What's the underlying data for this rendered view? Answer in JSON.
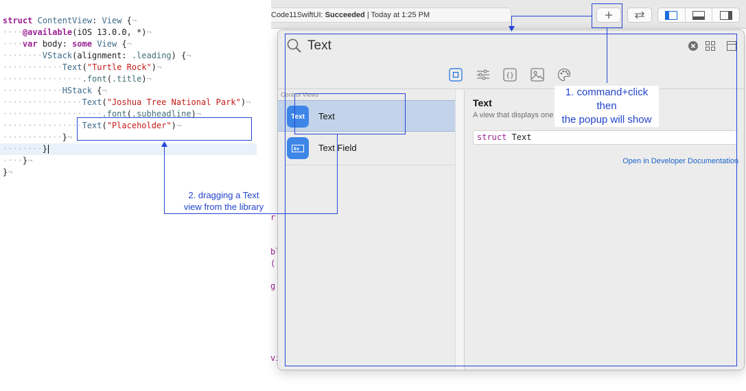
{
  "editor": {
    "lines": [
      {
        "tokens": [
          {
            "t": "struct",
            "c": "kw"
          },
          {
            "t": " "
          },
          {
            "t": "ContentView",
            "c": "ty"
          },
          {
            "t": ": "
          },
          {
            "t": "View",
            "c": "ty"
          },
          {
            "t": " {"
          }
        ],
        "pilcrow": true
      },
      {
        "tokens": [
          {
            "t": "····",
            "c": "dots"
          },
          {
            "t": "@available",
            "c": "kw"
          },
          {
            "t": "(iOS 13.0.0, *)"
          }
        ],
        "pilcrow": true
      },
      {
        "tokens": [
          {
            "t": "····",
            "c": "dots"
          },
          {
            "t": "var",
            "c": "kw"
          },
          {
            "t": " body: "
          },
          {
            "t": "some",
            "c": "kw"
          },
          {
            "t": " "
          },
          {
            "t": "View",
            "c": "ty"
          },
          {
            "t": " {"
          }
        ],
        "pilcrow": true
      },
      {
        "tokens": [
          {
            "t": "········",
            "c": "dots"
          },
          {
            "t": "VStack",
            "c": "ty"
          },
          {
            "t": "(alignment: "
          },
          {
            "t": ".leading",
            "c": "fn"
          },
          {
            "t": ") {"
          }
        ],
        "pilcrow": true
      },
      {
        "tokens": [
          {
            "t": "············",
            "c": "dots"
          },
          {
            "t": "Text",
            "c": "ty"
          },
          {
            "t": "("
          },
          {
            "t": "\"Turtle Rock\"",
            "c": "str"
          },
          {
            "t": ")"
          }
        ],
        "pilcrow": true
      },
      {
        "tokens": [
          {
            "t": "················",
            "c": "dots"
          },
          {
            "t": ".font",
            "c": "fn"
          },
          {
            "t": "("
          },
          {
            "t": ".title",
            "c": "fn"
          },
          {
            "t": ")"
          }
        ],
        "pilcrow": true
      },
      {
        "tokens": [
          {
            "t": "············",
            "c": "dots"
          },
          {
            "t": "HStack",
            "c": "ty"
          },
          {
            "t": " {"
          }
        ],
        "pilcrow": true
      },
      {
        "tokens": [
          {
            "t": "················",
            "c": "dots"
          },
          {
            "t": "Text",
            "c": "ty"
          },
          {
            "t": "("
          },
          {
            "t": "\"Joshua Tree National Park\"",
            "c": "str"
          },
          {
            "t": ")"
          }
        ],
        "pilcrow": true
      },
      {
        "tokens": [
          {
            "t": "····················",
            "c": "dots"
          },
          {
            "t": ".font",
            "c": "fn"
          },
          {
            "t": "("
          },
          {
            "t": ".subheadline",
            "c": "fn"
          },
          {
            "t": ")"
          }
        ],
        "pilcrow": true
      },
      {
        "tokens": [
          {
            "t": "················",
            "c": "dots"
          },
          {
            "t": "Text",
            "c": "ty"
          },
          {
            "t": "("
          },
          {
            "t": "\"Placeholder\"",
            "c": "str"
          },
          {
            "t": ")"
          }
        ],
        "pilcrow": true
      },
      {
        "tokens": [
          {
            "t": "············",
            "c": "dots"
          },
          {
            "t": "}"
          }
        ],
        "pilcrow": true
      },
      {
        "tokens": [
          {
            "t": "········",
            "c": "dots"
          },
          {
            "t": "}"
          }
        ],
        "pilcrow": false,
        "highlighted": true,
        "cursor": true
      },
      {
        "tokens": [
          {
            "t": "····",
            "c": "dots"
          },
          {
            "t": "}"
          }
        ],
        "pilcrow": true
      },
      {
        "tokens": [
          {
            "t": "}"
          }
        ],
        "pilcrow": true
      }
    ],
    "pilcrow_char": "¬",
    "behind_popup_letters": [
      "r",
      "bl",
      "(",
      "g",
      "vi"
    ]
  },
  "toolbar": {
    "status_scheme": "Code11SwiftUI: ",
    "status_result": "Succeeded",
    "status_time": " | Today at 1:25 PM",
    "library_button_icon": "plus-icon",
    "code_review_icon": "swap-arrows-icon",
    "layout_icons": [
      "navigator-panel-icon",
      "debug-area-icon",
      "inspector-panel-icon"
    ]
  },
  "library": {
    "search_value": "Text",
    "search_icon": "magnifier-icon",
    "clear_icon": "clear-circle-icon",
    "grid_icon": "grid-view-icon",
    "detail_toggle_icon": "detail-panel-icon",
    "tabs": [
      {
        "icon": "views-square-icon",
        "selected": true
      },
      {
        "icon": "modifiers-sliders-icon",
        "selected": false
      },
      {
        "icon": "snippets-braces-icon",
        "selected": false
      },
      {
        "icon": "media-image-icon",
        "selected": false
      },
      {
        "icon": "color-palette-icon",
        "selected": false
      }
    ],
    "section_header": "Control Views",
    "items": [
      {
        "icon_text": "Text",
        "label": "Text",
        "selected": true
      },
      {
        "icon_text": "Ex",
        "label": "Text Field",
        "selected": false
      }
    ],
    "detail": {
      "title": "Text",
      "description": "A view that displays one or more lines of read-only text.",
      "declaration_keyword": "struct",
      "declaration_name": " Text",
      "doc_link": "Open in Developer Documentation"
    }
  },
  "annotations": {
    "step1": [
      "1. command+click",
      "then",
      "the popup will show"
    ],
    "step2": [
      "2. dragging a Text",
      "view from the library"
    ],
    "color": "#2345d6"
  }
}
